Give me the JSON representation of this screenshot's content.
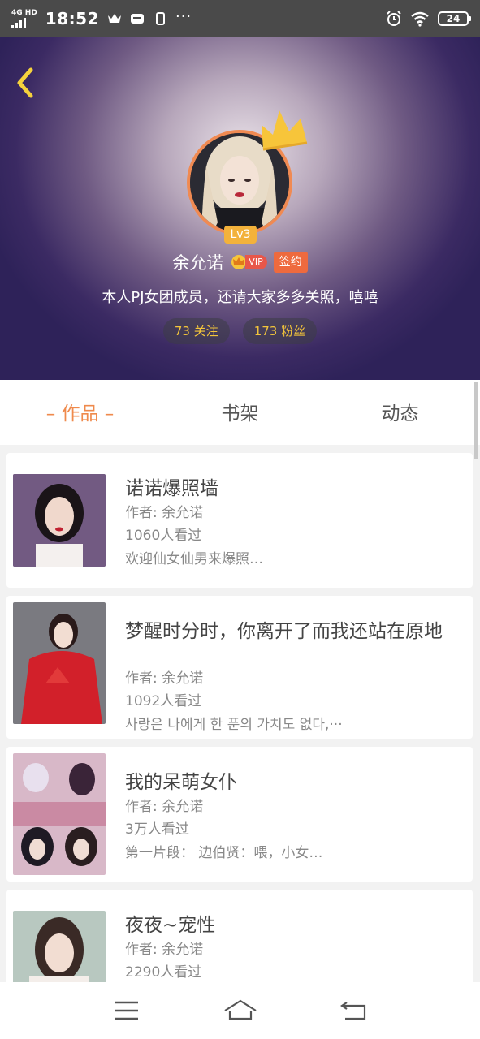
{
  "status_bar": {
    "network": "4G HD",
    "time": "18:52",
    "battery": "24"
  },
  "profile": {
    "level": "Lv3",
    "name": "余允诺",
    "vip_label": "VIP",
    "sign_label": "签约",
    "bio": "本人PJ女团成员，还请大家多多关照，嘻嘻",
    "following": "73 关注",
    "fans": "173 粉丝"
  },
  "tabs": [
    {
      "label": "– 作品 –",
      "active": true
    },
    {
      "label": "书架",
      "active": false
    },
    {
      "label": "动态",
      "active": false
    }
  ],
  "works": [
    {
      "title": "诺诺爆照墙",
      "author": "作者: 余允诺",
      "views": "1060人看过",
      "desc": "欢迎仙女仙男来爆照…"
    },
    {
      "title": "梦醒时分时，你离开了而我还站在原地",
      "author": "作者: 余允诺",
      "views": "1092人看过",
      "desc": "사랑은 나에게 한 푼의 가치도 없다,···"
    },
    {
      "title": "我的呆萌女仆",
      "author": "作者: 余允诺",
      "views": "3万人看过",
      "desc": "第一片段：  边伯贤：喂，小女…"
    },
    {
      "title": "夜夜~宠性",
      "author": "作者: 余允诺",
      "views": "2290人看过",
      "desc": ""
    }
  ],
  "colors": {
    "accent": "#ef8a4c",
    "stat_text": "#f3c53b",
    "header_dark": "#2e2259"
  }
}
